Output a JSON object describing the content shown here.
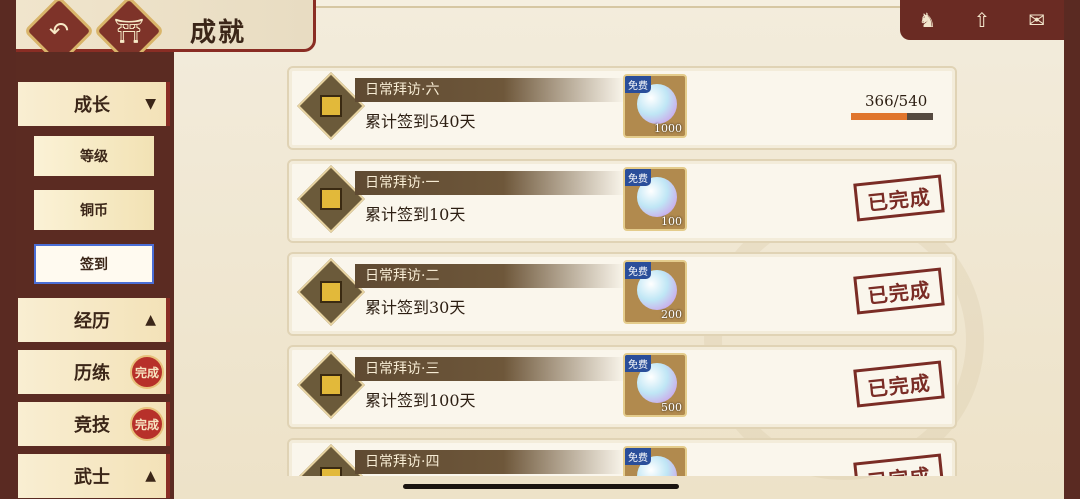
{
  "header": {
    "title": "成就",
    "back_icon": "back-arrow-icon",
    "home_icon": "home-gate-icon"
  },
  "top_right": {
    "icons": [
      "helmet-icon",
      "upgrade-arrow-icon",
      "mail-icon"
    ]
  },
  "sidebar": {
    "items": [
      {
        "label": "成长",
        "arrow": "▼"
      },
      {
        "label": "等级"
      },
      {
        "label": "铜币"
      },
      {
        "label": "签到"
      },
      {
        "label": "经历",
        "arrow": "▲"
      },
      {
        "label": "历练",
        "badge": "完成"
      },
      {
        "label": "竞技",
        "badge": "完成"
      },
      {
        "label": "武士",
        "arrow": "▲"
      }
    ]
  },
  "achievements": [
    {
      "name": "日常拜访·六",
      "desc": "累计签到540天",
      "free": "免费",
      "qty": "1000",
      "progress_text": "366/540",
      "progress": 0.678,
      "status": ""
    },
    {
      "name": "日常拜访·一",
      "desc": "累计签到10天",
      "free": "免费",
      "qty": "100",
      "status": "已完成"
    },
    {
      "name": "日常拜访·二",
      "desc": "累计签到30天",
      "free": "免费",
      "qty": "200",
      "status": "已完成"
    },
    {
      "name": "日常拜访·三",
      "desc": "累计签到100天",
      "free": "免费",
      "qty": "500",
      "status": "已完成"
    },
    {
      "name": "日常拜访·四",
      "desc": "",
      "free": "免费",
      "qty": "",
      "status": "已完成"
    }
  ],
  "colors": {
    "frame": "#5a2a22",
    "accent_red": "#8a2d24",
    "progress": "#e0752c",
    "selected_outline": "#4a6ed6"
  }
}
